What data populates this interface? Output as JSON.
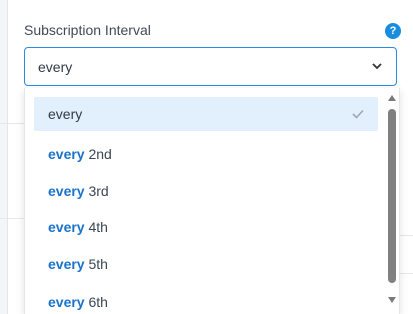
{
  "field": {
    "label": "Subscription Interval",
    "help_icon": "question-circle-icon",
    "help_glyph": "?",
    "accent_color": "#1a8cde"
  },
  "select": {
    "value": "every",
    "chevron_icon": "chevron-down-icon"
  },
  "options": [
    {
      "keyword": "every",
      "suffix": "",
      "selected": true
    },
    {
      "keyword": "every",
      "suffix": " 2nd",
      "selected": false
    },
    {
      "keyword": "every",
      "suffix": " 3rd",
      "selected": false
    },
    {
      "keyword": "every",
      "suffix": " 4th",
      "selected": false
    },
    {
      "keyword": "every",
      "suffix": " 5th",
      "selected": false
    },
    {
      "keyword": "every",
      "suffix": " 6th",
      "selected": false
    }
  ],
  "selected_check_icon": "check-icon",
  "scrollbar": {
    "up_icon": "scroll-up-arrow-icon",
    "down_icon": "scroll-down-arrow-icon"
  }
}
